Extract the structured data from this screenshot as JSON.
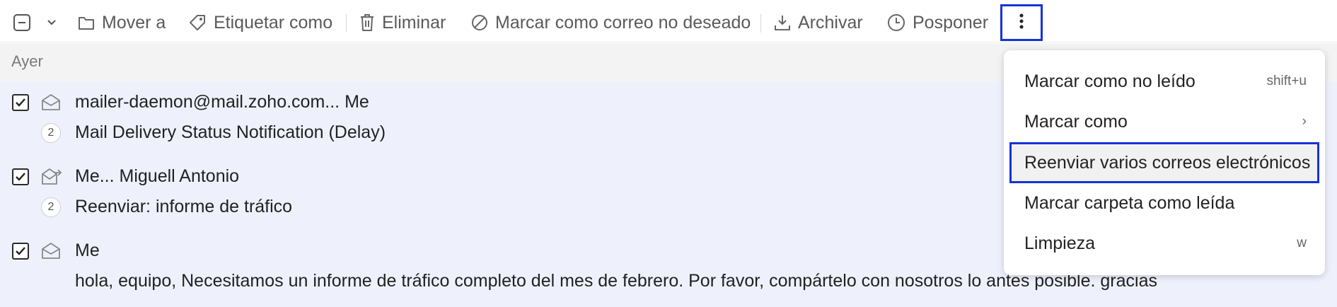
{
  "toolbar": {
    "select_all_icon": "minus-checkbox-icon",
    "dropdown_icon": "chevron-down-icon",
    "move_to": "Mover a",
    "tag_as": "Etiquetar como",
    "delete": "Eliminar",
    "mark_spam": "Marcar como correo no deseado",
    "archive": "Archivar",
    "snooze": "Posponer",
    "more_icon": "vertical-dots-icon"
  },
  "section": {
    "label": "Ayer"
  },
  "emails": [
    {
      "checked": true,
      "icon": "envelope-open-icon",
      "sender": "mailer-daemon@mail.zoho.com... Me",
      "count": "2",
      "subject": "Mail Delivery Status Notification (Delay)"
    },
    {
      "checked": true,
      "icon": "envelope-forward-icon",
      "sender": "Me... Miguell Antonio",
      "count": "2",
      "subject": "Reenviar: informe de tráfico"
    },
    {
      "checked": true,
      "icon": "envelope-open-icon",
      "sender": "Me",
      "count": "",
      "subject": "hola, equipo, Necesitamos un informe de tráfico completo del mes de febrero. Por favor, compártelo con nosotros lo antes posible. gracias"
    }
  ],
  "menu": {
    "items": [
      {
        "label": "Marcar como no leído",
        "shortcut": "shift+u"
      },
      {
        "label": "Marcar como",
        "shortcut": "›"
      },
      {
        "label": "Reenviar varios correos electrónicos",
        "shortcut": ""
      },
      {
        "label": "Marcar carpeta como leída",
        "shortcut": ""
      },
      {
        "label": "Limpieza",
        "shortcut": "w"
      }
    ],
    "highlighted_index": 2
  },
  "colors": {
    "accent": "#1533d6",
    "list_bg": "#eef1fc",
    "section_bg": "#f3f3f3"
  }
}
